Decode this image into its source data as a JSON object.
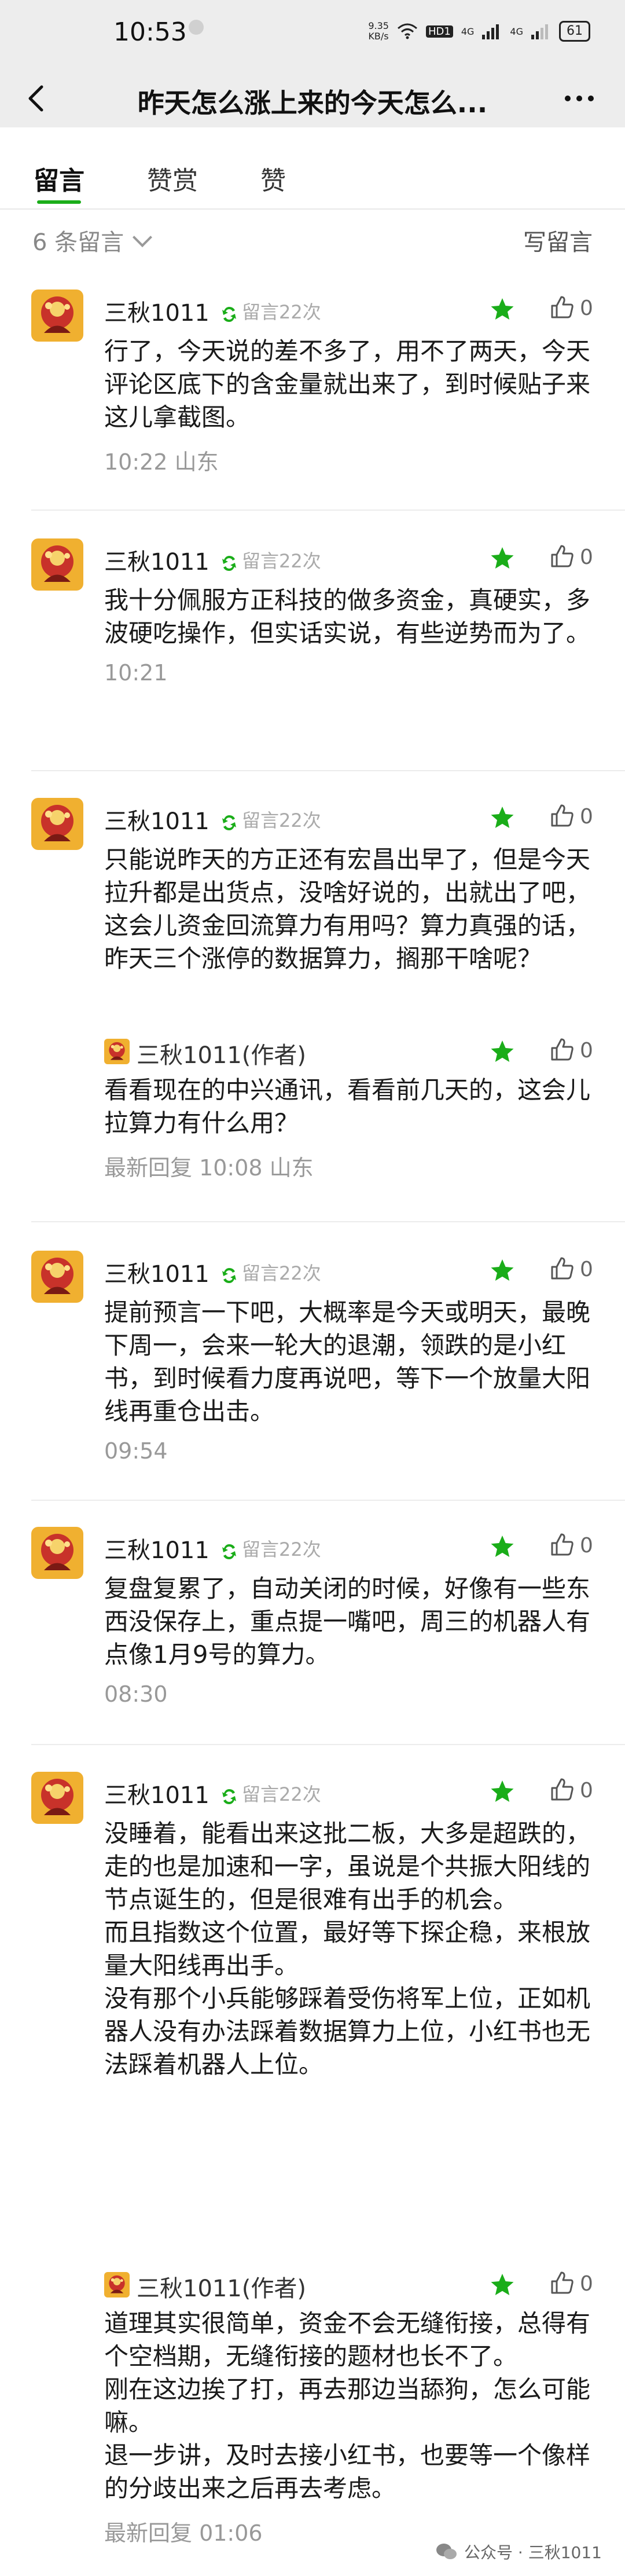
{
  "status_bar": {
    "time": "10:53",
    "speed": "9.35\nKB/s",
    "hd": "HD1",
    "net1": "4G",
    "net2": "4G",
    "battery": "61"
  },
  "nav": {
    "title": "昨天怎么涨上来的今天怎么..."
  },
  "tabs": [
    "留言",
    "赞赏",
    "赞"
  ],
  "count_label": "6 条留言",
  "write_label": "写留言",
  "comments": [
    {
      "name": "三秋1011",
      "tag": "留言22次",
      "likes": "0",
      "text": "行了，今天说的差不多了，用不了两天，今天评论区底下的含金量就出来了，到时候贴子来这儿拿截图。",
      "meta": "10:22  山东"
    },
    {
      "name": "三秋1011",
      "tag": "留言22次",
      "likes": "0",
      "text": "我十分佩服方正科技的做多资金，真硬实，多波硬吃操作，但实话实说，有些逆势而为了。",
      "meta": "10:21"
    },
    {
      "name": "三秋1011",
      "tag": "留言22次",
      "likes": "0",
      "text": "只能说昨天的方正还有宏昌出早了，但是今天拉升都是出货点，没啥好说的，出就出了吧，这会儿资金回流算力有用吗？算力真强的话，昨天三个涨停的数据算力，搁那干啥呢？",
      "reply": {
        "name": "三秋1011(作者)",
        "likes": "0",
        "text": "看看现在的中兴通讯，看看前几天的，这会儿拉算力有什么用？",
        "meta": "最新回复 10:08  山东"
      }
    },
    {
      "name": "三秋1011",
      "tag": "留言22次",
      "likes": "0",
      "text": "提前预言一下吧，大概率是今天或明天，最晚下周一，会来一轮大的退潮，领跌的是小红书，到时候看力度再说吧，等下一个放量大阳线再重仓出击。",
      "meta": "09:54"
    },
    {
      "name": "三秋1011",
      "tag": "留言22次",
      "likes": "0",
      "text": "复盘复累了，自动关闭的时候，好像有一些东西没保存上，重点提一嘴吧，周三的机器人有点像1月9号的算力。",
      "meta": "08:30"
    },
    {
      "name": "三秋1011",
      "tag": "留言22次",
      "likes": "0",
      "text": "没睡着，能看出来这批二板，大多是超跌的，走的也是加速和一字，虽说是个共振大阳线的节点诞生的，但是很难有出手的机会。\n而且指数这个位置，最好等下探企稳，来根放量大阳线再出手。\n没有那个小兵能够踩着受伤将军上位，正如机器人没有办法踩着数据算力上位，小红书也无法踩着机器人上位。",
      "reply": {
        "name": "三秋1011(作者)",
        "likes": "0",
        "text": "道理其实很简单，资金不会无缝衔接，总得有个空档期，无缝衔接的题材也长不了。\n刚在这边挨了打，再去那边当舔狗，怎么可能嘛。\n退一步讲，及时去接小红书，也要等一个像样的分歧出来之后再去考虑。",
        "meta": "最新回复 01:06"
      }
    }
  ],
  "watermark": "公众号 · 三秋1011",
  "colors": {
    "accent": "#1aad19",
    "star": "#1aad19",
    "bg_bar": "#ededed"
  }
}
